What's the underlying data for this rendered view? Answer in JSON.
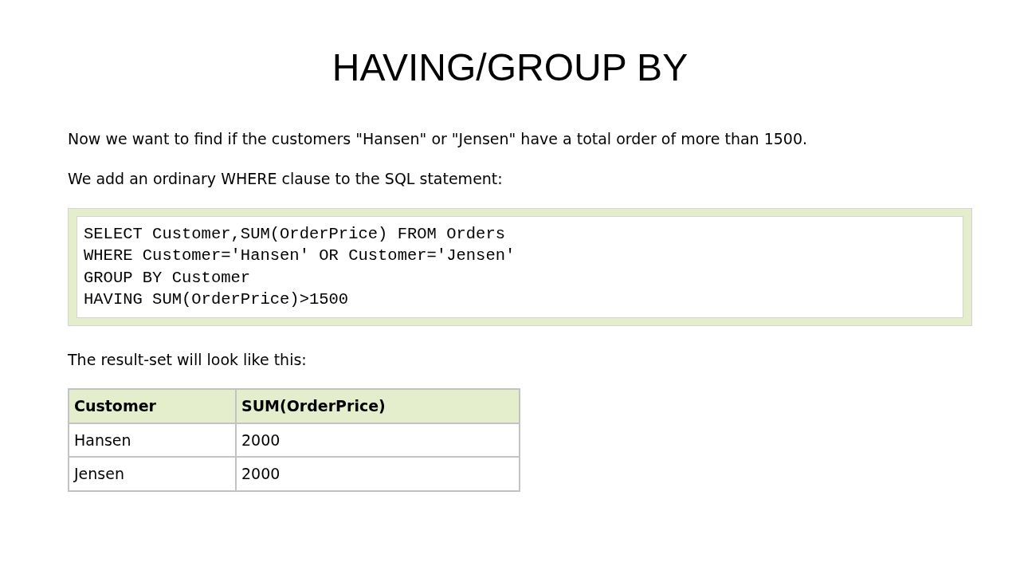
{
  "title": "HAVING/GROUP BY",
  "paragraphs_top": [
    "Now we want to find if the customers \"Hansen\" or \"Jensen\" have a total order of more than 1500.",
    "We add an ordinary WHERE clause to the SQL statement:"
  ],
  "code_lines": [
    "SELECT Customer,SUM(OrderPrice) FROM Orders",
    "WHERE Customer='Hansen' OR Customer='Jensen'",
    "GROUP BY Customer",
    "HAVING SUM(OrderPrice)>1500"
  ],
  "result_caption": "The result-set will look like this:",
  "table": {
    "columns": [
      "Customer",
      "SUM(OrderPrice)"
    ],
    "rows": [
      [
        "Hansen",
        "2000"
      ],
      [
        "Jensen",
        "2000"
      ]
    ]
  }
}
